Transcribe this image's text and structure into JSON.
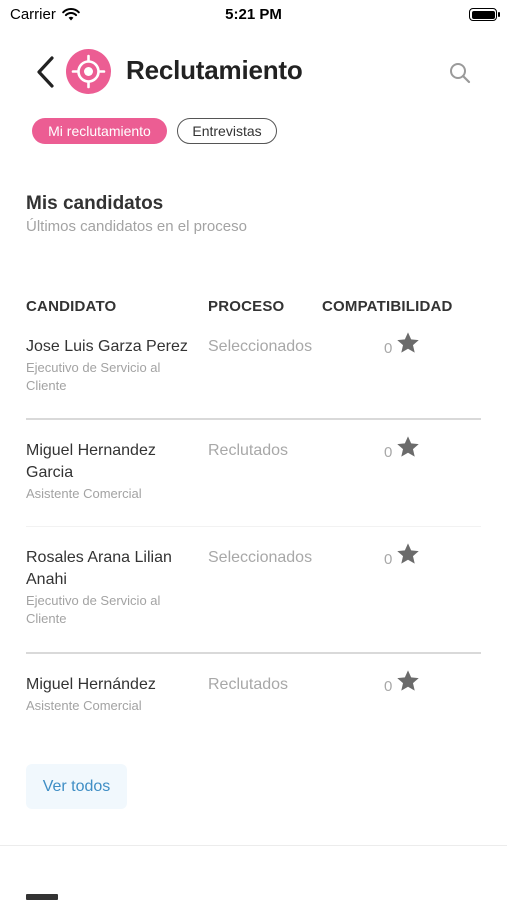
{
  "status_bar": {
    "carrier": "Carrier",
    "time": "5:21 PM"
  },
  "header": {
    "title": "Reclutamiento",
    "logo_icon": "target-icon",
    "search_icon": "search-icon",
    "back_icon": "chevron-left-icon"
  },
  "tabs": [
    {
      "label": "Mi reclutamiento",
      "active": true
    },
    {
      "label": "Entrevistas",
      "active": false
    }
  ],
  "section": {
    "title": "Mis candidatos",
    "subtitle": "Últimos candidatos en el proceso"
  },
  "table": {
    "headers": {
      "candidate": "CANDIDATO",
      "process": "PROCESO",
      "compatibility": "COMPATIBILIDAD"
    },
    "rows": [
      {
        "name": "Jose Luis Garza Perez",
        "role": "Ejecutivo de Servicio al Cliente",
        "process": "Seleccionados",
        "score": "0"
      },
      {
        "name": "Miguel Hernandez Garcia",
        "role": "Asistente Comercial",
        "process": "Reclutados",
        "score": "0"
      },
      {
        "name": "Rosales Arana Lilian Anahi",
        "role": "Ejecutivo de Servicio al Cliente",
        "process": "Seleccionados",
        "score": "0"
      },
      {
        "name": "Miguel Hernández",
        "role": "Asistente Comercial",
        "process": "Reclutados",
        "score": "0"
      }
    ]
  },
  "see_all_label": "Ver todos",
  "colors": {
    "accent": "#ec5d93",
    "link": "#3f8ec5",
    "muted": "#a3a3a3"
  }
}
